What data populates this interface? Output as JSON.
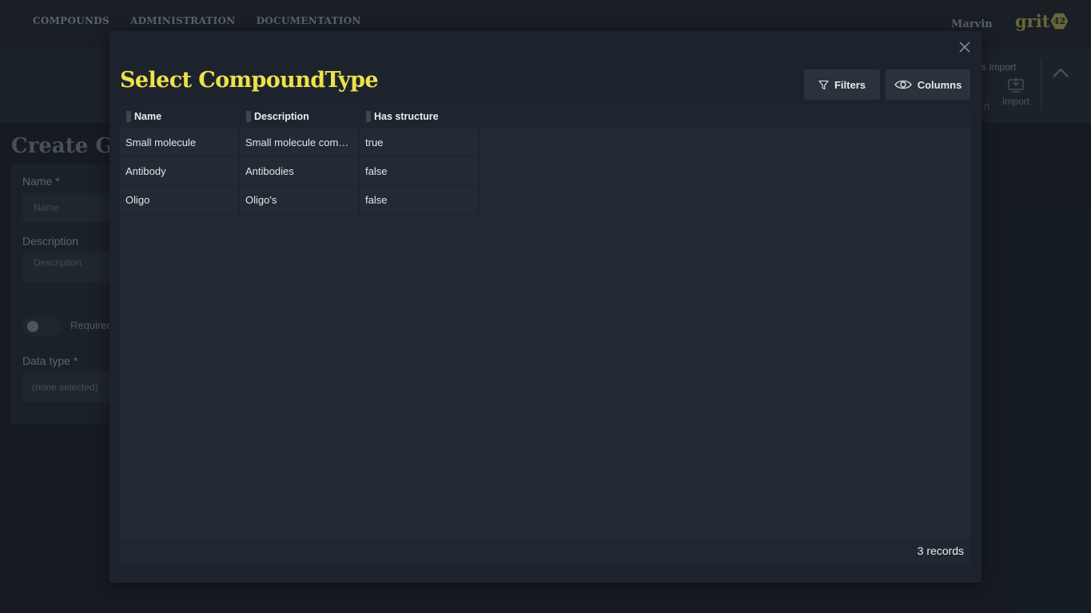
{
  "nav": {
    "items": [
      "COMPOUNDS",
      "ADMINISTRATION",
      "DOCUMENTATION"
    ],
    "user": "Marvin",
    "logo_text": "grit",
    "logo_badge": "42"
  },
  "toolbar": {
    "import_top_label": "s Import",
    "partial_label": "rt",
    "import_label": "Import"
  },
  "form": {
    "title": "Create Gr",
    "name_label": "Name *",
    "name_placeholder": "Name",
    "description_label": "Description",
    "description_placeholder": "Description",
    "required_label": "Required",
    "data_type_label": "Data type *",
    "data_type_value": "(none selected)"
  },
  "modal": {
    "title": "Select CompoundType",
    "filters_label": "Filters",
    "columns_label": "Columns",
    "grid": {
      "columns": [
        "Name",
        "Description",
        "Has structure"
      ],
      "rows": [
        [
          "Small molecule",
          "Small molecule com…",
          "true"
        ],
        [
          "Antibody",
          "Antibodies",
          "false"
        ],
        [
          "Oligo",
          "Oligo's",
          "false"
        ]
      ]
    },
    "records_label": "3 records"
  },
  "colors": {
    "accent_yellow": "#ece24a",
    "background": "#1c222b",
    "panel": "#222a34"
  },
  "icons": [
    "close-icon",
    "filter-icon",
    "eye-icon",
    "import-icon",
    "chevron-up-icon"
  ]
}
